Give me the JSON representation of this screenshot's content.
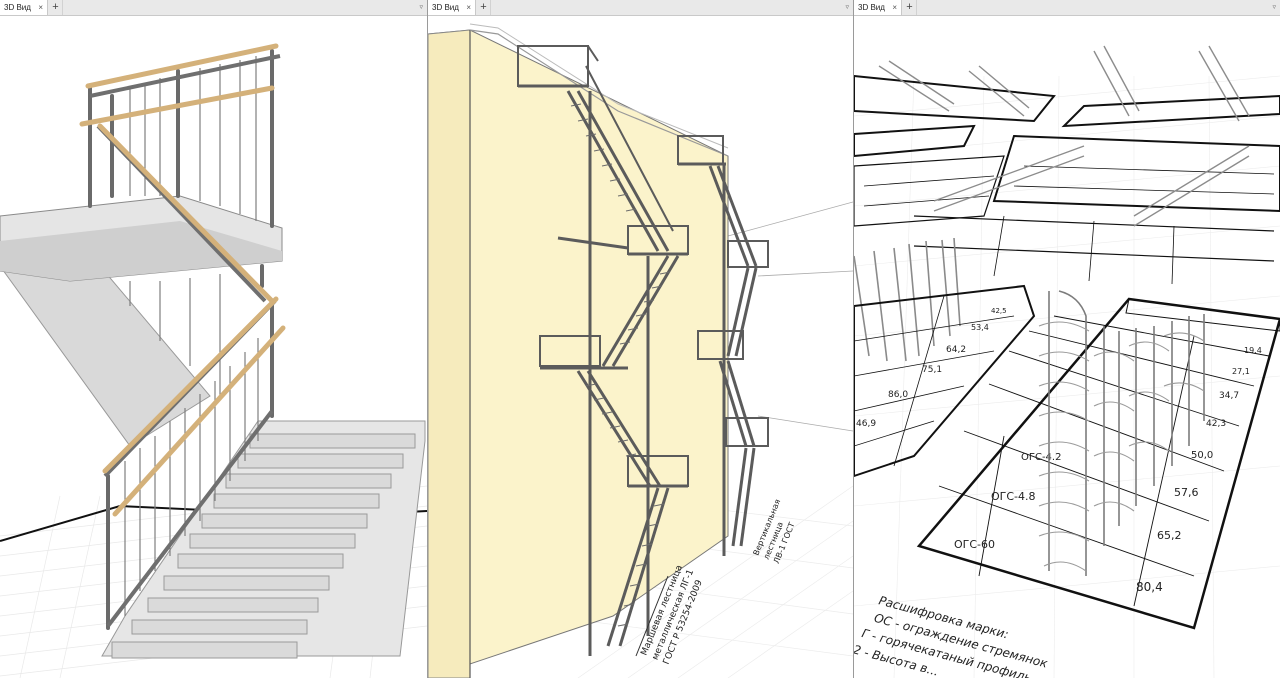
{
  "tabs": [
    {
      "label": "3D Вид",
      "close": "×",
      "add": "+",
      "menu": "▿"
    },
    {
      "label": "3D Вид",
      "close": "×",
      "add": "+",
      "menu": "▿"
    },
    {
      "label": "3D Вид",
      "close": "×",
      "add": "+",
      "menu": "▿"
    }
  ],
  "view2": {
    "annotation_main": [
      "Маршевая лестница",
      "металлическая ЛГ-1",
      "ГОСТ Р 53254-2009"
    ],
    "annotation_side": [
      "Вертикальная",
      "лестница",
      "ЛВ-1 ГОСТ"
    ]
  },
  "view3": {
    "schedule_marks": [
      "ОГС-60",
      "ОГС-4.8",
      "ОГС-4.2"
    ],
    "schedule_values": [
      "80,4",
      "65,2",
      "57,6",
      "50,0",
      "42,3",
      "34,7",
      "27,1",
      "19,4"
    ],
    "schedule_left_values": [
      "46,9",
      "86,0",
      "75,1",
      "64,2",
      "53,4",
      "42,5"
    ],
    "legend": [
      "Расшифровка марки:",
      "ОС - ограждение стремянок",
      "Г - горячекатаный профиль",
      "2 - Высота в..."
    ]
  },
  "colors": {
    "wall": "#fbf3cb",
    "steel": "#5b5b5b",
    "handrail_wood": "#d4b17a",
    "concrete": "#d8d8d8",
    "grid": "#e6e6e6"
  }
}
